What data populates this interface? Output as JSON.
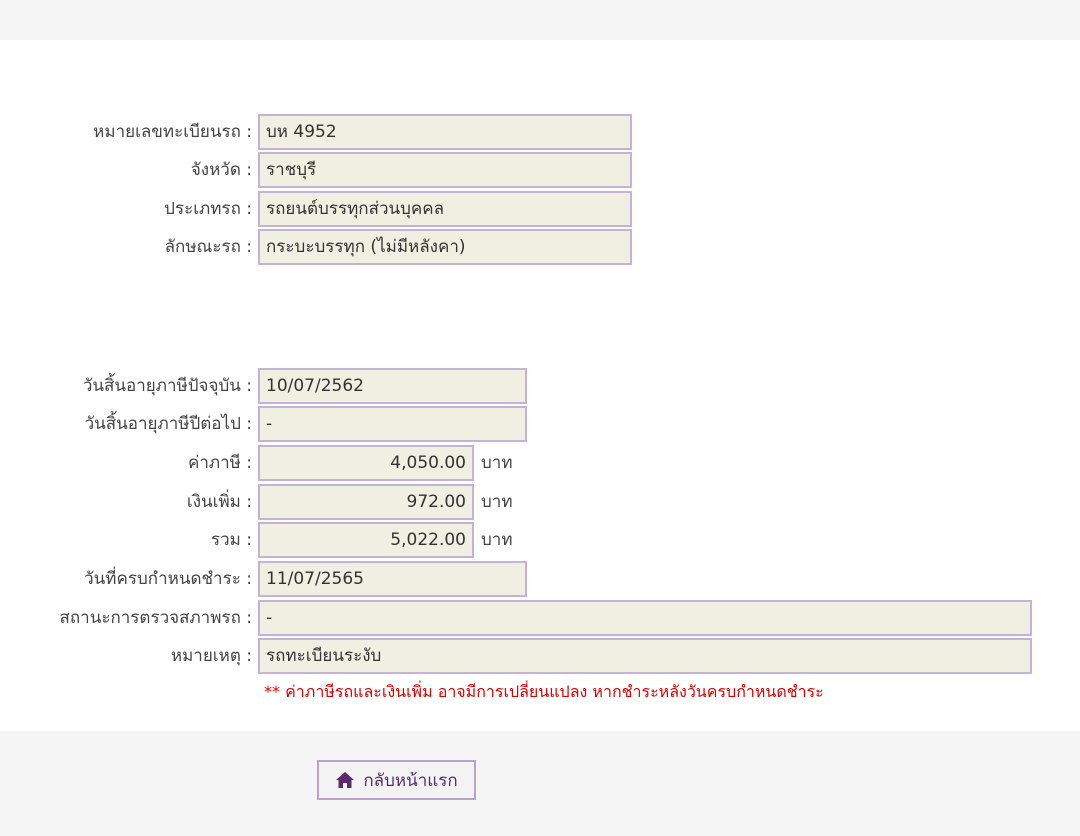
{
  "vehicle": {
    "plate_label": "หมายเลขทะเบียนรถ :",
    "plate_value": "บห 4952",
    "province_label": "จังหวัด :",
    "province_value": "ราชบุรี",
    "type_label": "ประเภทรถ :",
    "type_value": "รถยนต์บรรทุกส่วนบุคคล",
    "characteristic_label": "ลักษณะรถ :",
    "characteristic_value": "กระบะบรรทุก (ไม่มีหลังคา)"
  },
  "tax": {
    "current_expiry_label": "วันสิ้นอายุภาษีปัจจุบัน :",
    "current_expiry_value": "10/07/2562",
    "next_expiry_label": "วันสิ้นอายุภาษีปีต่อไป :",
    "next_expiry_value": "-",
    "tax_label": "ค่าภาษี :",
    "tax_value": "4,050.00",
    "surcharge_label": "เงินเพิ่ม :",
    "surcharge_value": "972.00",
    "total_label": "รวม :",
    "total_value": "5,022.00",
    "unit": "บาท",
    "due_date_label": "วันที่ครบกำหนดชำระ :",
    "due_date_value": "11/07/2565",
    "inspection_label": "สถานะการตรวจสภาพรถ :",
    "inspection_value": "-",
    "remark_label": "หมายเหตุ :",
    "remark_value": "รถทะเบียนระงับ"
  },
  "note": "** ค่าภาษีรถและเงินเพิ่ม อาจมีการเปลี่ยนแปลง หากชำระหลังวันครบกำหนดชำระ",
  "home_button": {
    "label": "กลับหน้าแรก",
    "icon": "home-icon"
  },
  "colors": {
    "field_bg": "#efefe2",
    "field_border": "#c6b2d8",
    "note": "#dd0000",
    "accent": "#5a2a6f"
  }
}
